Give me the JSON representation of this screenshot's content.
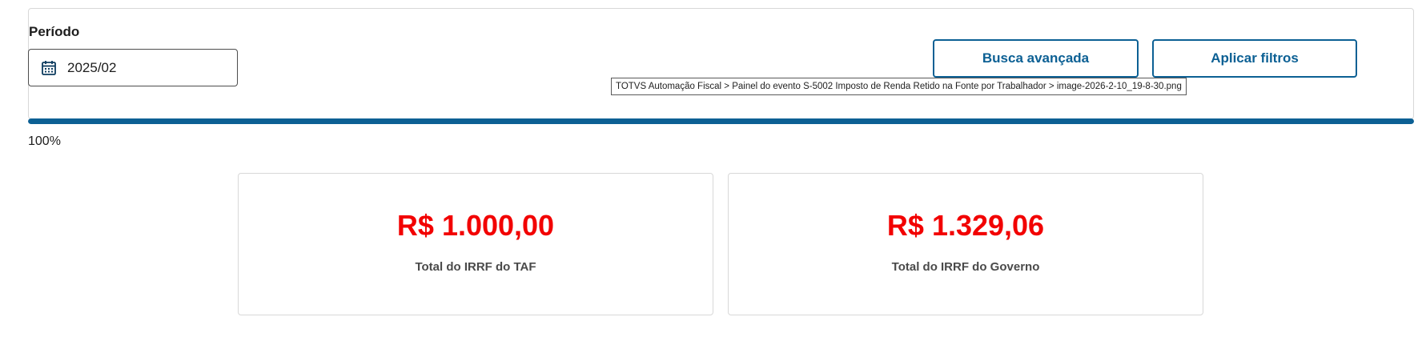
{
  "filters": {
    "period_label": "Período",
    "period_value": "2025/02",
    "advanced_search_label": "Busca avançada",
    "apply_filters_label": "Aplicar filtros"
  },
  "tooltip": {
    "text": "TOTVS Automação Fiscal > Painel do evento S-5002 Imposto de Renda Retido na Fonte por Trabalhador > image-2026-2-10_19-8-30.png"
  },
  "progress": {
    "value": 1.0,
    "label": "100%"
  },
  "totals": [
    {
      "amount": "R$ 1.000,00",
      "caption": "Total do IRRF do TAF"
    },
    {
      "amount": "R$ 1.329,06",
      "caption": "Total do IRRF do Governo"
    }
  ],
  "icons": {
    "period": "calendar-icon"
  },
  "colors": {
    "primary": "#0c6094",
    "amount": "#f20000",
    "border": "#d8d8d8"
  }
}
